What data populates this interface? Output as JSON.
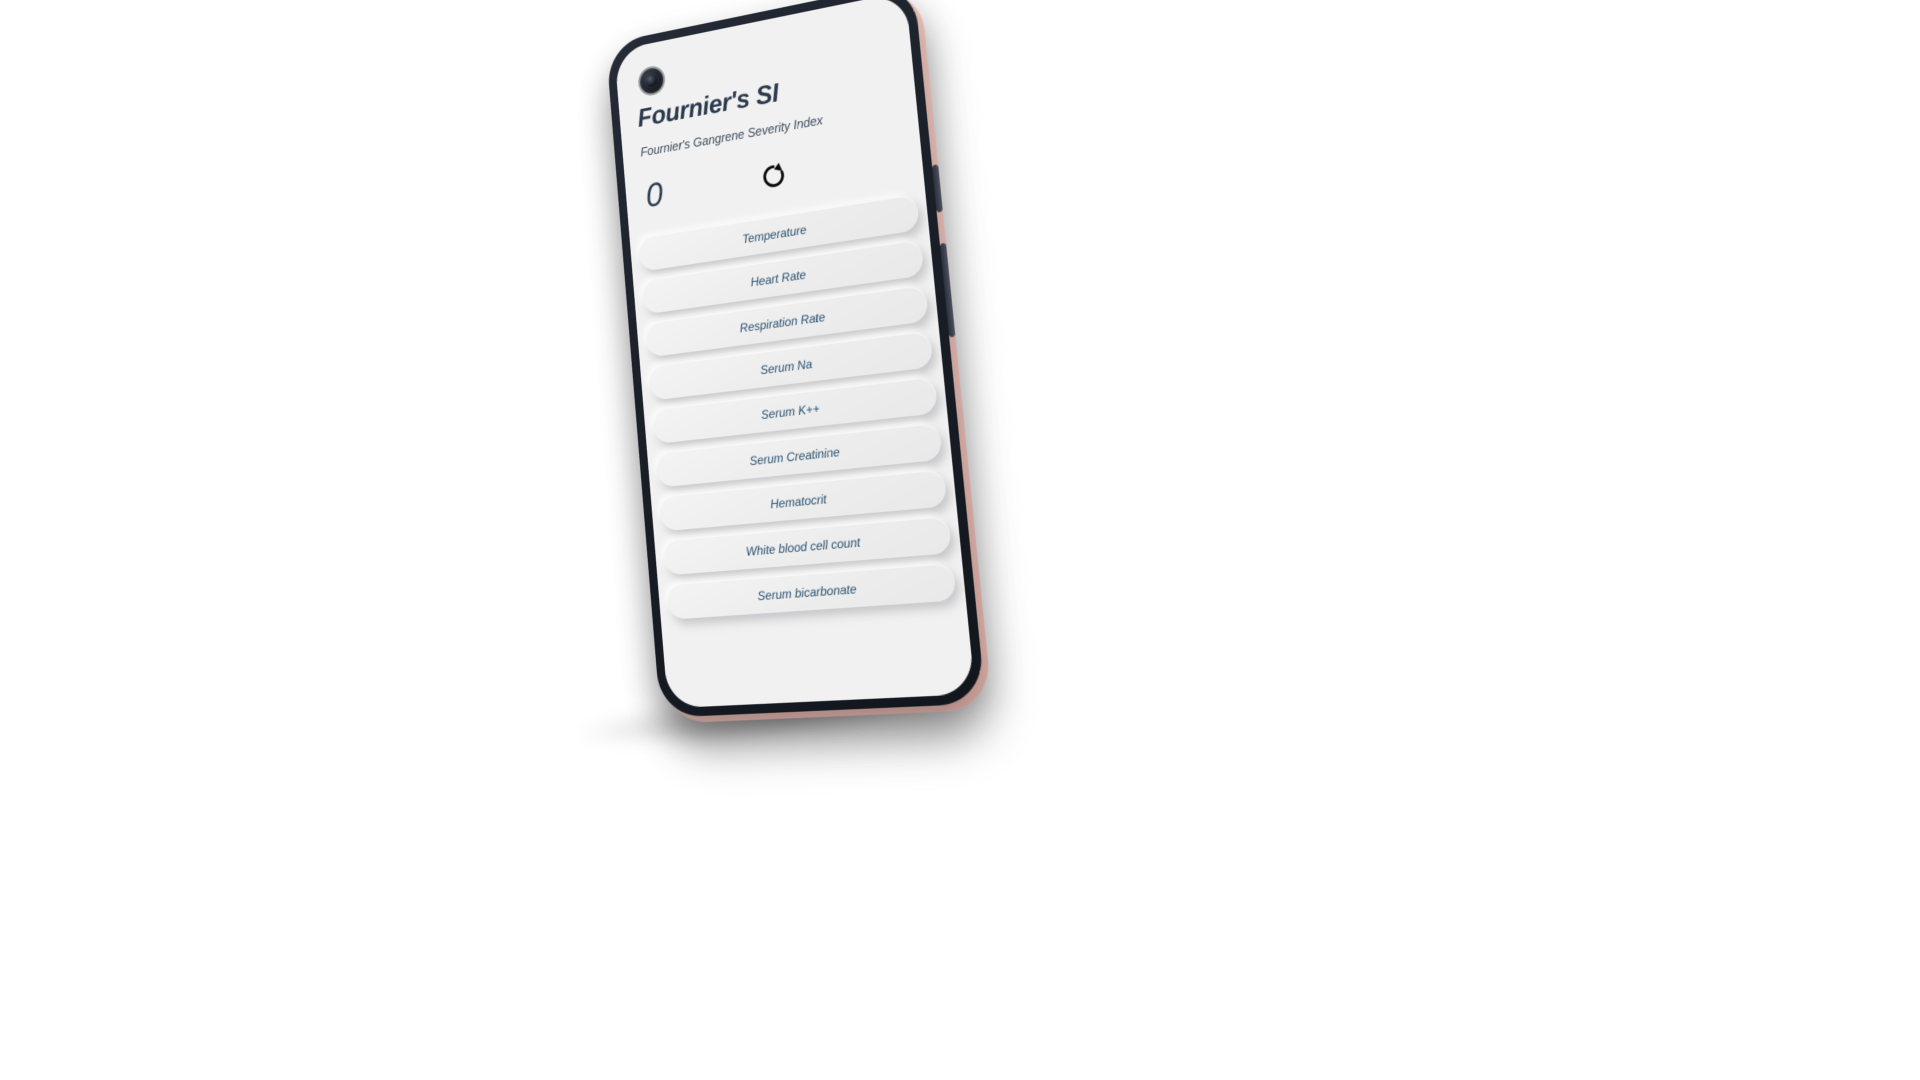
{
  "device": {
    "type": "smartphone-mockup",
    "frame_color": "#1b2029",
    "backshell_color": "#eec3bb",
    "screen_background": "#f1f1f1"
  },
  "app": {
    "title": "Fournier's SI",
    "subtitle": "Fournier's Gangrene Severity Index",
    "score": {
      "value": "0",
      "color": "#2f3f52"
    },
    "reset": {
      "icon": "refresh-icon",
      "label": "Reset"
    },
    "accent_text_color": "#27506e",
    "fields": [
      {
        "label": "Temperature"
      },
      {
        "label": "Heart Rate"
      },
      {
        "label": "Respiration Rate"
      },
      {
        "label": "Serum Na"
      },
      {
        "label": "Serum K++"
      },
      {
        "label": "Serum Creatinine"
      },
      {
        "label": "Hematocrit"
      },
      {
        "label": "White blood cell count"
      },
      {
        "label": "Serum bicarbonate"
      }
    ]
  }
}
